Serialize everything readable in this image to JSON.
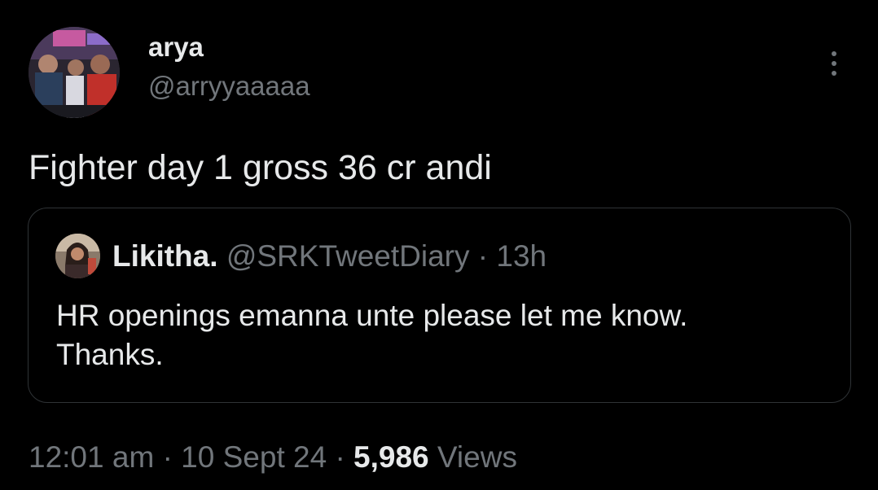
{
  "author": {
    "name": "arya",
    "handle": "@arryyaaaaa",
    "avatar_icon": "profile-photo"
  },
  "tweet": {
    "text": "Fighter day 1 gross 36 cr andi"
  },
  "more_icon": "vertical-ellipsis-icon",
  "quoted_tweet": {
    "name": "Likitha.",
    "handle": "@SRKTweetDiary",
    "separator": "·",
    "time": "13h",
    "text_line1": "HR openings emanna unte please let me know.",
    "text_line2": "Thanks.",
    "avatar_icon": "profile-photo"
  },
  "meta": {
    "time": "12:01 am",
    "separator1": "·",
    "date": "10 Sept 24",
    "separator2": "·",
    "views_count": "5,986",
    "views_label": "Views"
  },
  "colors": {
    "background": "#000000",
    "primary_text": "#e7e9ea",
    "secondary_text": "#71767b",
    "border": "#2f3336"
  }
}
